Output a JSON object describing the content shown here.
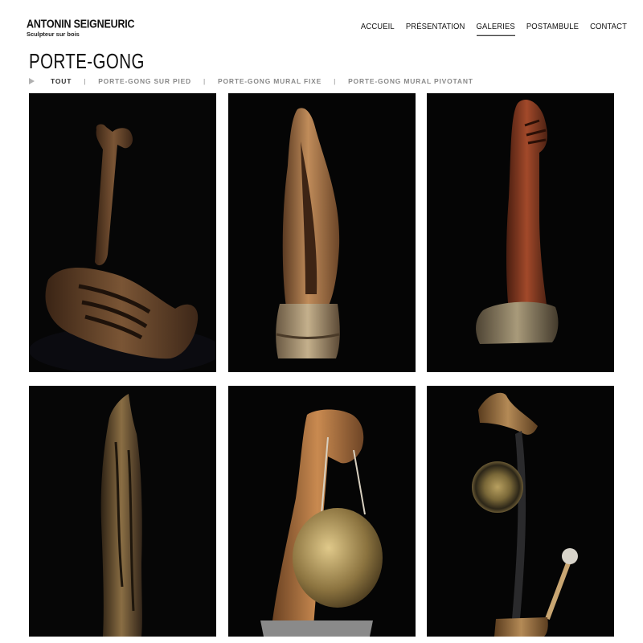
{
  "header": {
    "brand_name": "ANTONIN SEIGNEURIC",
    "brand_subtitle": "Sculpteur sur bois",
    "nav": [
      {
        "label": "ACCUEIL"
      },
      {
        "label": "PRÉSENTATION"
      },
      {
        "label": "GALERIES",
        "active": true
      },
      {
        "label": "POSTAMBULE"
      },
      {
        "label": "CONTACT"
      }
    ]
  },
  "page": {
    "title": "PORTE-GONG"
  },
  "filters": {
    "items": [
      {
        "label": "TOUT",
        "active": true
      },
      {
        "label": "PORTE-GONG SUR PIED"
      },
      {
        "label": "PORTE-GONG MURAL FIXE"
      },
      {
        "label": "PORTE-GONG MURAL PIVOTANT"
      }
    ],
    "separator": "|"
  },
  "gallery": {
    "items": [
      {
        "subject": "wood sculpture hand-shaped gong holder"
      },
      {
        "subject": "tall carved wood gong holder on log base"
      },
      {
        "subject": "red wood gong holder on rough base"
      },
      {
        "subject": "tall totem wood sculpture"
      },
      {
        "subject": "wood gong holder with brass gong"
      },
      {
        "subject": "pivoting gong holder with mallet"
      }
    ]
  },
  "colors": {
    "tile_background": "#050505",
    "filter_text": "#8a8a8a",
    "filter_active": "#333333"
  }
}
